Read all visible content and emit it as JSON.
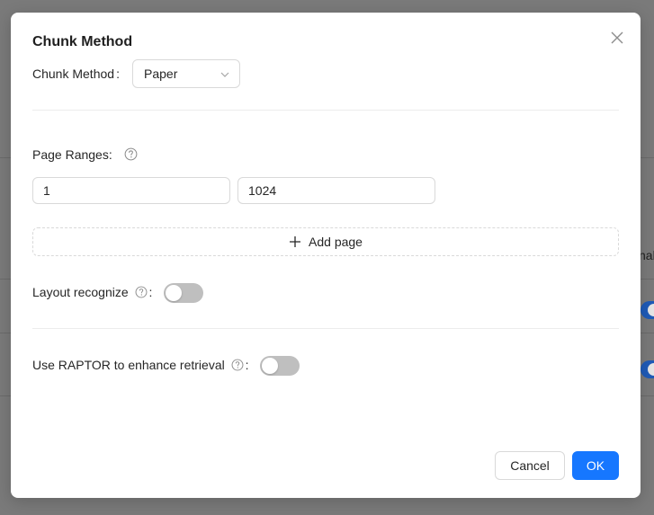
{
  "background": {
    "column_header_fragment": "nal"
  },
  "modal": {
    "title": "Chunk Method",
    "close_icon": "close-icon",
    "chunk_method": {
      "label": "Chunk Method",
      "colon": ":",
      "selected": "Paper"
    },
    "page_ranges": {
      "label": "Page Ranges:",
      "from_value": "1",
      "to_value": "1024",
      "add_label": "Add page"
    },
    "layout_recognize": {
      "label": "Layout recognize",
      "colon": ":",
      "enabled": false
    },
    "raptor": {
      "label": "Use RAPTOR to enhance retrieval",
      "colon": ":",
      "enabled": false
    },
    "footer": {
      "cancel_label": "Cancel",
      "ok_label": "OK"
    }
  },
  "colors": {
    "primary": "#1677ff",
    "switch_off": "#bfbfbf",
    "border": "#d9d9d9"
  }
}
